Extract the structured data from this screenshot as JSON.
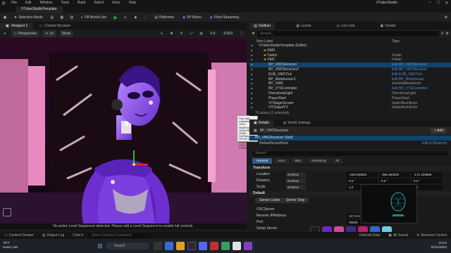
{
  "menubar": {
    "items": [
      "File",
      "Edit",
      "Window",
      "Tools",
      "Build",
      "Select",
      "Actor",
      "Help"
    ],
    "app_title": "VTuberStudio"
  },
  "project_tab": "VTuberStudioTemplate",
  "toolbar": {
    "mode": "Selection Mode",
    "world": "Off World Live",
    "platforms": "Platforms",
    "vp_roles": "VP Roles",
    "pixel_streaming": "Pixel Streaming"
  },
  "viewport": {
    "tabs": [
      "Viewport 1",
      "Content Browser"
    ],
    "perspective": "Perspective",
    "lit": "Lit",
    "show": "Show",
    "fov": "0.5",
    "camera_speed": "0.003",
    "message": "No active Level Sequencer detected. Please edit a Level Sequence to enable full controls.",
    "tooltip_lines": [
      "Face data estimated: 100%",
      "HeadPose",
      "1920x1080 120Hz",
      "",
      "Full Body",
      "FPS:57.09",
      "ARKit:52",
      "LIVE:0 120 0.0000"
    ]
  },
  "outliner": {
    "tabs": [
      "Outliner",
      "Levels",
      "Live Link",
      "Details"
    ],
    "search_placeholder": "Search...",
    "col_label": "Item Label",
    "col_type": "Type",
    "rows": [
      {
        "name": "VTuberStudioTemplate (Editor)",
        "type": "",
        "indent": 1
      },
      {
        "name": "DMX",
        "type": "",
        "indent": 2,
        "folder": true
      },
      {
        "name": "Twitch",
        "type": "Folder",
        "indent": 2,
        "folder": true
      },
      {
        "name": "VMC",
        "type": "Folder",
        "indent": 2,
        "folder": true
      },
      {
        "name": "BP_VMCReceiver",
        "type": "Edit BP_VMCReceiver",
        "indent": 3,
        "selected": true
      },
      {
        "name": "BP_VMCReceiver2",
        "type": "Edit BP_VMCReceiver",
        "indent": 3
      },
      {
        "name": "EUB_VMCTick",
        "type": "Edit EUB_VMCTick",
        "indent": 3
      },
      {
        "name": "BP_Metahuman1",
        "type": "Edit BP_Metahuman",
        "indent": 3
      },
      {
        "name": "BP_VRM",
        "type": "SkeletalMeshActor",
        "indent": 3
      },
      {
        "name": "BP_VTSController",
        "type": "Edit BP_VTSController",
        "indent": 3
      },
      {
        "name": "DirectionalLight",
        "type": "DirectionalLight",
        "indent": 3
      },
      {
        "name": "PlayerStart",
        "type": "PlayerStart",
        "indent": 3
      },
      {
        "name": "VTStageScreen",
        "type": "StaticMeshActor",
        "indent": 3
      },
      {
        "name": "VTOutputTV",
        "type": "StaticMeshActor",
        "indent": 3
      }
    ],
    "footer": "70 actors (1 selected)"
  },
  "details": {
    "tabs": [
      "Details",
      "World Settings"
    ],
    "actor_name": "BP_VMCReceiver",
    "add_label": "+ Add",
    "component_self": "BP_VMCReceiver (Self)",
    "component_child": "DefaultSceneRoot",
    "edit_bp": "Edit in Blueprint",
    "search_placeholder": "Search",
    "categories": [
      "General",
      "Actor",
      "Misc",
      "Streaming",
      "All"
    ],
    "transform_header": "Transform",
    "transform": [
      {
        "label": "Location",
        "mode": "Relative",
        "x": "-230.608584",
        "y": "-366.394002",
        "z": "-171.109986"
      },
      {
        "label": "Rotation",
        "mode": "Relative",
        "x": "0.0 °",
        "y": "0.0 °",
        "z": "0.0 °"
      },
      {
        "label": "Scale",
        "mode": "Relative",
        "x": "1.0",
        "y": "1.0",
        "z": "1.0"
      }
    ],
    "default_header": "Default",
    "server_listen": "Server Listen",
    "server_stop": "Server Stop",
    "osc_server": "OSCServer",
    "receive_ip": "Receive IPAddress",
    "port": "Port",
    "ip_value": "127.0.0.1",
    "port_value": "39539",
    "extra_row": "Setup Server"
  },
  "statusbar": {
    "items": [
      "Content Drawer",
      "Output Log",
      "Cmd"
    ],
    "cmd_placeholder": "Enter Console Command",
    "right": [
      "Derived Data",
      "All Saved",
      "Revision Control"
    ]
  },
  "taskbar": {
    "temp": "78°F",
    "weather": "Heavy rain",
    "search": "Search",
    "time": "23:24",
    "date": "02/11/2023"
  }
}
